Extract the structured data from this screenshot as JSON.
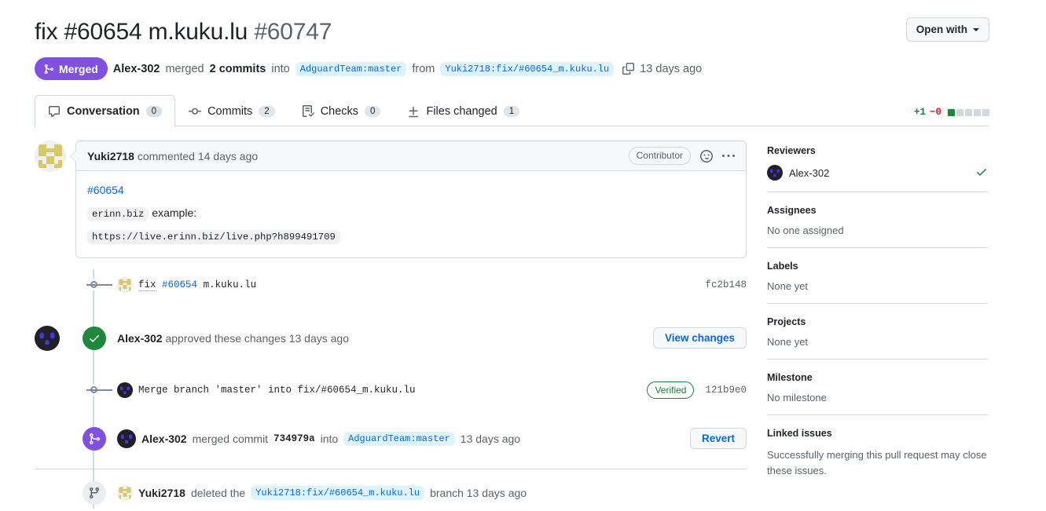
{
  "header": {
    "title": "fix #60654 m.kuku.lu",
    "pr_number": "#60747",
    "open_with_label": "Open with",
    "state": "Merged",
    "merged_by": "Alex-302",
    "merged_text_1": "merged",
    "commits_count_text": "2 commits",
    "into_text": "into",
    "base_branch": "AdguardTeam:master",
    "from_text": "from",
    "head_branch": "Yuki2718:fix/#60654_m.kuku.lu",
    "merged_when": "13 days ago"
  },
  "tabs": [
    {
      "label": "Conversation",
      "count": "0",
      "icon": "comment-icon",
      "active": true
    },
    {
      "label": "Commits",
      "count": "2",
      "icon": "commit-icon",
      "active": false
    },
    {
      "label": "Checks",
      "count": "0",
      "icon": "checklist-icon",
      "active": false
    },
    {
      "label": "Files changed",
      "count": "1",
      "icon": "diff-icon",
      "active": false
    }
  ],
  "diffstat": {
    "additions": "+1",
    "deletions": "−0",
    "blocks_total": 5,
    "blocks_filled": 1,
    "add_color": "#1a7f37",
    "del_color": "#cf222e",
    "block_on_color": "#1f883d",
    "block_off_color": "#d1d9e0"
  },
  "comment": {
    "author": "Yuki2718",
    "action": "commented 14 days ago",
    "badge": "Contributor",
    "reaction_icon": "smiley-icon",
    "menu_icon": "kebab-horizontal-icon",
    "issue_ref": "#60654",
    "code_domain": "erinn.biz",
    "example_label": "example:",
    "code_url": "https://live.erinn.biz/live.php?h899491709"
  },
  "timeline": {
    "commit1": {
      "msg_prefix": "fix",
      "msg_link": "#60654",
      "msg_suffix": "m.kuku.lu",
      "sha": "fc2b148",
      "icon": "commit-dot-icon"
    },
    "approval": {
      "actor": "Alex-302",
      "text": "approved these changes 13 days ago",
      "button": "View changes",
      "icon": "check-circle-icon"
    },
    "commit2": {
      "msg": "Merge branch 'master' into fix/#60654_m.kuku.lu",
      "verified": "Verified",
      "sha": "121b9e0",
      "icon": "commit-dot-icon"
    },
    "merged": {
      "actor": "Alex-302",
      "text_1": "merged commit",
      "sha": "734979a",
      "text_2": "into",
      "branch": "AdguardTeam:master",
      "when": "13 days ago",
      "button": "Revert",
      "icon": "git-merge-icon"
    },
    "deleted": {
      "actor": "Yuki2718",
      "text_1": "deleted the",
      "branch": "Yuki2718:fix/#60654_m.kuku.lu",
      "text_2": "branch 13 days ago",
      "icon": "git-branch-icon"
    }
  },
  "sidebar": {
    "reviewers": {
      "title": "Reviewers",
      "name": "Alex-302",
      "status_icon": "check-icon"
    },
    "assignees": {
      "title": "Assignees",
      "value": "No one assigned"
    },
    "labels": {
      "title": "Labels",
      "value": "None yet"
    },
    "projects": {
      "title": "Projects",
      "value": "None yet"
    },
    "milestone": {
      "title": "Milestone",
      "value": "No milestone"
    },
    "linked_issues": {
      "title": "Linked issues",
      "value": "Successfully merging this pull request may close these issues."
    }
  }
}
